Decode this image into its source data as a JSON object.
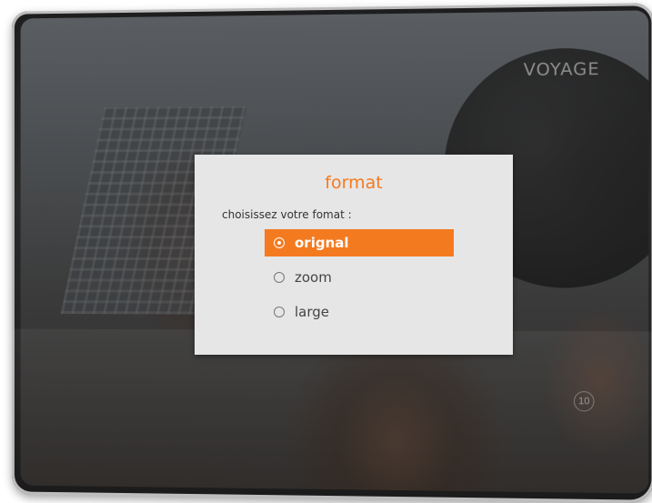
{
  "screen": {
    "brand_logo": "VOYAGE",
    "channel_badge": "10"
  },
  "dialog": {
    "title": "format",
    "prompt": "choisissez votre fomat :",
    "options": [
      {
        "label": "orignal",
        "selected": true
      },
      {
        "label": "zoom",
        "selected": false
      },
      {
        "label": "large",
        "selected": false
      }
    ]
  },
  "colors": {
    "accent": "#f47a20",
    "dialog_bg": "#e6e6e6"
  }
}
